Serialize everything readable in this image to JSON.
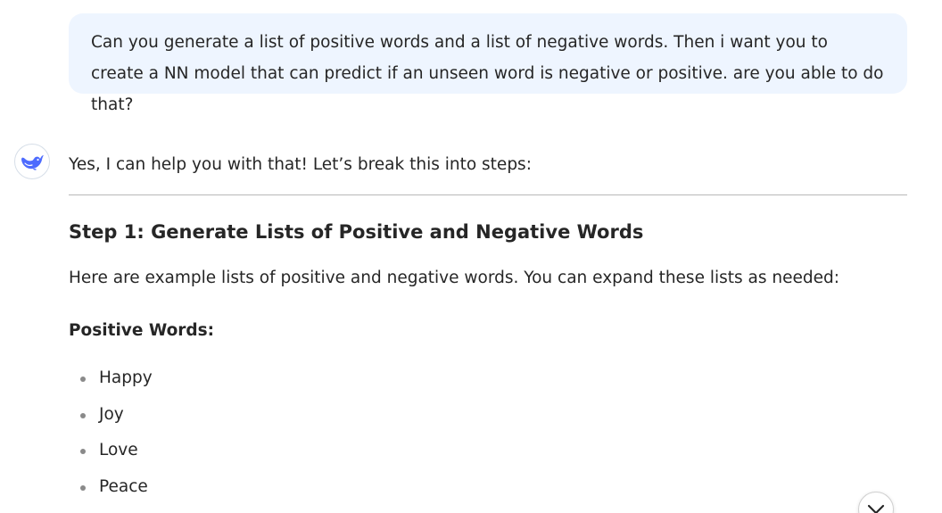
{
  "user_message": {
    "text": "Can you generate a list of positive words and a list of negative words. Then i want you to create a NN model that can predict if an unseen word is negative or positive. are you able to do that?"
  },
  "assistant": {
    "avatar_icon": "deepseek-whale-icon",
    "intro": "Yes, I can help you with that! Let’s break this into steps:",
    "step1_heading": "Step 1: Generate Lists of Positive and Negative Words",
    "step1_text": "Here are example lists of positive and negative words. You can expand these lists as needed:",
    "positive_title": "Positive Words:",
    "positive_words": [
      "Happy",
      "Joy",
      "Love",
      "Peace"
    ]
  },
  "controls": {
    "scroll_down_icon": "chevron-down-icon"
  },
  "colors": {
    "user_bubble_bg": "#eef5ff",
    "accent": "#4d6bfe",
    "text": "#262626"
  }
}
